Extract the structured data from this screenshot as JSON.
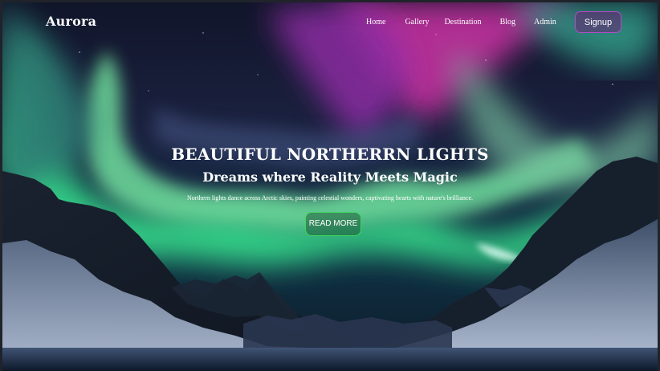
{
  "brand": {
    "name": "Aurora"
  },
  "nav": {
    "items": [
      {
        "label": "Home"
      },
      {
        "label": "Gallery"
      },
      {
        "label": "Destination"
      },
      {
        "label": "Blog"
      },
      {
        "label": "Admin"
      }
    ],
    "signup_label": "Signup"
  },
  "hero": {
    "title": "BEAUTIFUL NORTHERRN LIGHTS",
    "subtitle": "Dreams where Reality Meets Magic",
    "description": "Northern lights dance across Arctic skies, painting celestial wonders, captivating hearts with nature's brilliance.",
    "button_label": "READ MORE"
  },
  "colors": {
    "accent_button": "#b04cc5",
    "cta_border": "#41d65f",
    "aurora_green": "#5cf29a",
    "aurora_magenta": "#c0309a"
  }
}
